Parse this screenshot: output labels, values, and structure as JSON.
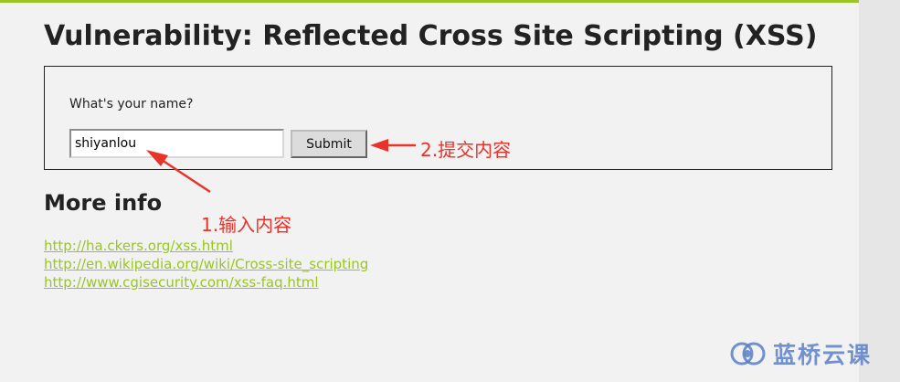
{
  "page": {
    "title": "Vulnerability: Reflected Cross Site Scripting (XSS)"
  },
  "form": {
    "prompt": "What's your name?",
    "name_value": "shiyanlou",
    "submit_label": "Submit"
  },
  "more_info": {
    "heading": "More info",
    "links": [
      "http://ha.ckers.org/xss.html",
      "http://en.wikipedia.org/wiki/Cross-site_scripting",
      "http://www.cgisecurity.com/xss-faq.html"
    ]
  },
  "annotations": {
    "step1": "1.输入内容",
    "step2": "2.提交内容",
    "color": "#e8332a"
  },
  "watermark": {
    "text": "蓝桥云课",
    "color": "#5a7fc8"
  },
  "colors": {
    "accent": "#9ac523",
    "background": "#f2f2f2"
  }
}
